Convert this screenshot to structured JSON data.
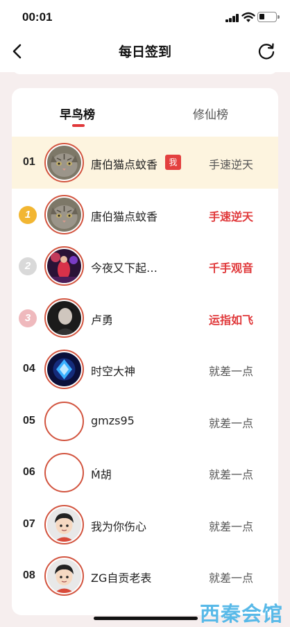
{
  "status_bar": {
    "time": "00:01"
  },
  "nav": {
    "title": "每日签到"
  },
  "tabs": [
    {
      "label": "早鸟榜",
      "active": true
    },
    {
      "label": "修仙榜",
      "active": false
    }
  ],
  "ranking": [
    {
      "rank": "01",
      "name": "唐伯猫点蚊香",
      "title": "手速逆天",
      "is_me": true,
      "me_label": "我",
      "avatar": "cat-avatar"
    },
    {
      "rank": "1",
      "medal": "gold",
      "name": "唐伯猫点蚊香",
      "title": "手速逆天",
      "avatar": "cat-avatar"
    },
    {
      "rank": "2",
      "medal": "silver",
      "name": "今夜又下起…",
      "title": "千手观音",
      "avatar": "concert-avatar"
    },
    {
      "rank": "3",
      "medal": "bronze",
      "name": "卢勇",
      "title": "运指如飞",
      "avatar": "portrait-avatar"
    },
    {
      "rank": "04",
      "name": "时空大神",
      "title": "就差一点",
      "avatar": "blue-gem-avatar"
    },
    {
      "rank": "05",
      "name": "gmzs95",
      "title": "就差一点",
      "avatar": "blank-avatar"
    },
    {
      "rank": "06",
      "name": "Ḿ胡",
      "title": "就差一点",
      "avatar": "blank-avatar"
    },
    {
      "rank": "07",
      "name": "我为你伤心",
      "title": "就差一点",
      "avatar": "cartoon-avatar"
    },
    {
      "rank": "08",
      "name": "ZG自贡老表",
      "title": "就差一点",
      "avatar": "cartoon-avatar"
    }
  ],
  "watermark": "西秦会馆",
  "colors": {
    "accent": "#e0383a",
    "highlight_row": "#fdf4df",
    "avatar_border": "#d2543f",
    "background": "#f6eeee"
  }
}
